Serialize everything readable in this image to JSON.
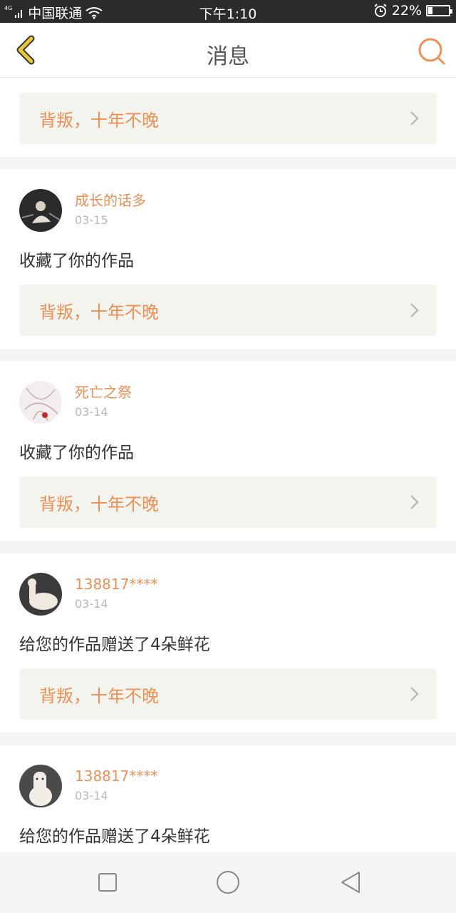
{
  "status_bar": {
    "network_tag": "4G",
    "carrier": "中国联通",
    "time": "下午1:10",
    "battery_text": "22%",
    "battery_level": 0.22
  },
  "header": {
    "title": "消息",
    "back_icon": "chevron-left-icon",
    "search_icon": "search-icon"
  },
  "colors": {
    "accent": "#ee8f56",
    "back_icon": "#e8c53a",
    "link_bg": "#f4f4ef"
  },
  "top_link": {
    "title": "背叛，十年不晚"
  },
  "messages": [
    {
      "username": "成长的话多",
      "date": "03-15",
      "action": "收藏了你的作品",
      "work_title": "背叛，十年不晚"
    },
    {
      "username": "死亡之祭",
      "date": "03-14",
      "action": "收藏了你的作品",
      "work_title": "背叛，十年不晚"
    },
    {
      "username": "138817****",
      "date": "03-14",
      "action": "给您的作品赠送了4朵鲜花",
      "work_title": "背叛，十年不晚"
    },
    {
      "username": "138817****",
      "date": "03-14",
      "action": "给您的作品赠送了4朵鲜花",
      "work_title": ""
    }
  ],
  "nav_bar": {
    "recent_icon": "square-icon",
    "home_icon": "circle-icon",
    "back_icon": "triangle-back-icon"
  }
}
